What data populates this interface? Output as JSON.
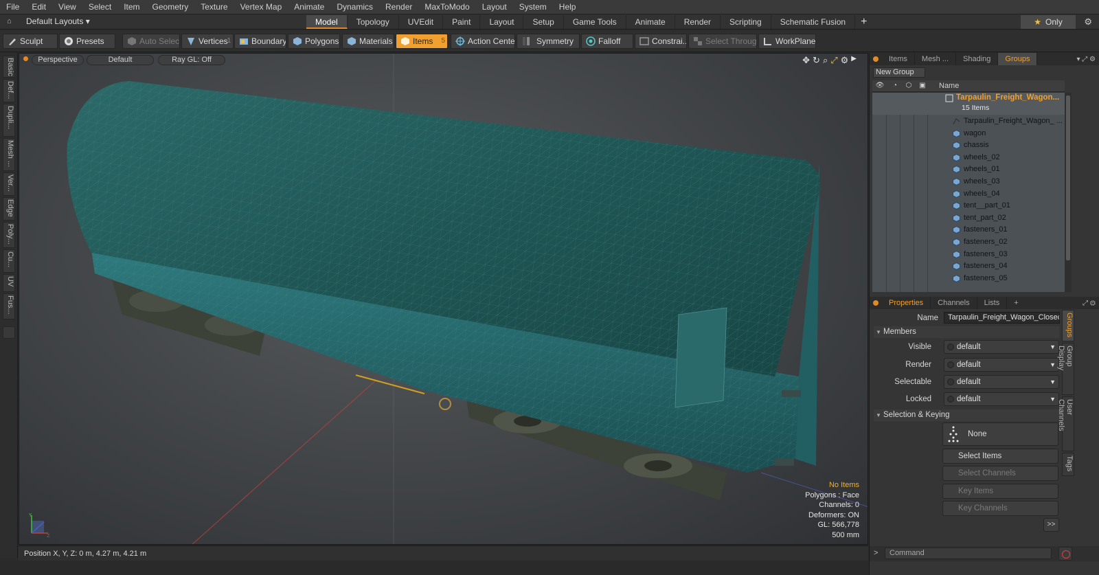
{
  "menu": [
    "File",
    "Edit",
    "View",
    "Select",
    "Item",
    "Geometry",
    "Texture",
    "Vertex Map",
    "Animate",
    "Dynamics",
    "Render",
    "MaxToModo",
    "Layout",
    "System",
    "Help"
  ],
  "layout": {
    "selector": "Default Layouts ▾",
    "tabs": [
      "Model",
      "Topology",
      "UVEdit",
      "Paint",
      "Layout",
      "Setup",
      "Game Tools",
      "Animate",
      "Render",
      "Scripting",
      "Schematic Fusion"
    ],
    "active_tab": "Model",
    "add": "+",
    "only": "Only"
  },
  "toolbar": {
    "sculpt": "Sculpt",
    "presets": "Presets",
    "auto_select": "Auto Select",
    "vertices": "Vertices",
    "vertices_num": "1",
    "boundary": "Boundary",
    "polygons": "Polygons",
    "materials": "Materials",
    "items": "Items",
    "items_num": "5",
    "action_center": "Action Center",
    "symmetry": "Symmetry",
    "falloff": "Falloff",
    "constraints": "Constrai...",
    "select_through": "Select Through",
    "workplane": "WorkPlane"
  },
  "left_tabs": [
    "Basic",
    "Def...",
    "Dupli...",
    "Mesh ...",
    "Ver...",
    "Edge",
    "Poly...",
    "Cu...",
    "UV",
    "Fus..."
  ],
  "viewport": {
    "view": "Perspective",
    "shading": "Default",
    "raygl": "Ray GL: Off",
    "stats": {
      "selection": "No Items",
      "polygons": "Polygons : Face",
      "channels": "Channels: 0",
      "deformers": "Deformers: ON",
      "gl": "GL: 566,778",
      "scale": "500 mm"
    }
  },
  "status": "Position X, Y, Z:   0 m, 4.27 m, 4.21 m",
  "panel_top": {
    "tabs": [
      "Items",
      "Mesh ...",
      "Shading",
      "Groups"
    ],
    "active_tab": "Groups",
    "new_group": "New Group",
    "name_header": "Name",
    "root": {
      "name": "Tarpaulin_Freight_Wagon...",
      "count": "15 Items"
    },
    "items": [
      "Tarpaulin_Freight_Wagon_ ...",
      "wagon",
      "chassis",
      "wheels_02",
      "wheels_01",
      "wheels_03",
      "wheels_04",
      "tent__part_01",
      "tent_part_02",
      "fasteners_01",
      "fasteners_02",
      "fasteners_03",
      "fasteners_04",
      "fasteners_05"
    ]
  },
  "panel_bottom": {
    "tabs": [
      "Properties",
      "Channels",
      "Lists",
      "+"
    ],
    "active_tab": "Properties",
    "name_label": "Name",
    "name_value": "Tarpaulin_Freight_Wagon_Closec",
    "members_section": "Members",
    "visible_label": "Visible",
    "visible_value": "default",
    "render_label": "Render",
    "render_value": "default",
    "selectable_label": "Selectable",
    "selectable_value": "default",
    "locked_label": "Locked",
    "locked_value": "default",
    "selkey_section": "Selection & Keying",
    "none_label": "None",
    "select_items": "Select Items",
    "select_channels": "Select Channels",
    "key_items": "Key Items",
    "key_channels": "Key Channels",
    "expand": ">>",
    "side_tabs": [
      "Groups",
      "Group Display",
      "User Channels",
      "Tags"
    ]
  },
  "command": {
    "prompt": ">",
    "placeholder": "Command"
  },
  "colors": {
    "accent": "#f0a030",
    "tarp": "#1f5a5c",
    "wagon_body": "#2b6d72"
  }
}
